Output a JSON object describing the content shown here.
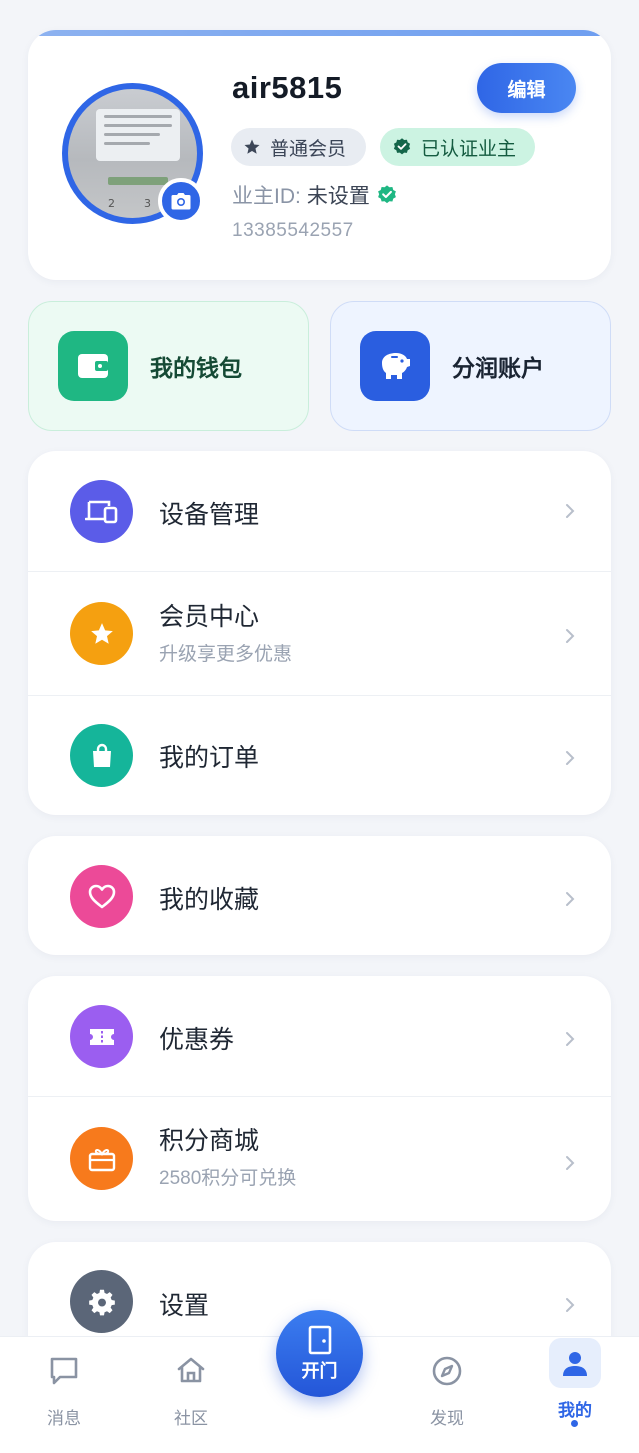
{
  "profile": {
    "username": "air5815",
    "edit_label": "编辑",
    "member_badge": "普通会员",
    "verified_badge": "已认证业主",
    "owner_id_label": "业主ID:",
    "owner_id_value": "未设置",
    "phone": "13385542557"
  },
  "tiles": {
    "wallet": "我的钱包",
    "share_account": "分润账户"
  },
  "menu": {
    "device": {
      "title": "设备管理"
    },
    "member_center": {
      "title": "会员中心",
      "subtitle": "升级享更多优惠"
    },
    "orders": {
      "title": "我的订单"
    },
    "favorites": {
      "title": "我的收藏"
    },
    "coupons": {
      "title": "优惠券"
    },
    "points_mall": {
      "title": "积分商城",
      "subtitle": "2580积分可兑换"
    },
    "settings": {
      "title": "设置"
    }
  },
  "nav": {
    "messages": "消息",
    "community": "社区",
    "open_door": "开门",
    "discover": "发现",
    "mine": "我的"
  },
  "colors": {
    "primary": "#2f66e6",
    "green": "#1fb783",
    "device": "#5b5ce8",
    "member": "#f5a010",
    "orders": "#15b59a",
    "favorites": "#ec4a98",
    "coupons": "#9b5ef0",
    "points": "#f77a1c",
    "settings": "#5b6678"
  },
  "icons": {
    "chevron": "chevron-right-icon"
  }
}
